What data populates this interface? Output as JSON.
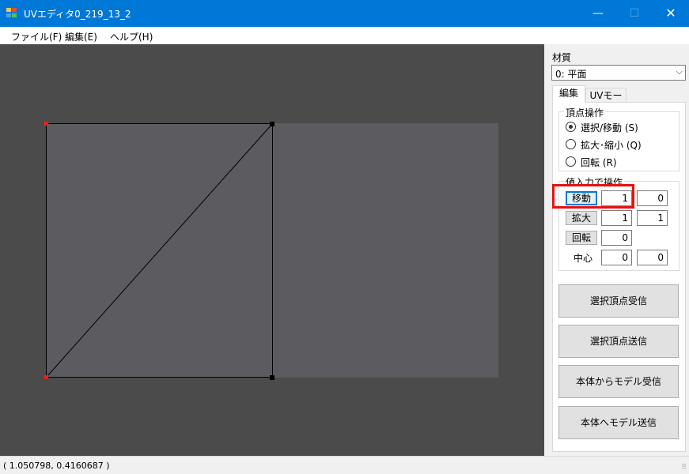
{
  "window": {
    "title": "UVエディタ0_219_13_2",
    "minimize_glyph": "—",
    "maximize_glyph": "☐",
    "close_glyph": "✕"
  },
  "menu": {
    "items": [
      "ファイル(F)",
      "編集(E)",
      "ヘルプ(H)"
    ]
  },
  "panel": {
    "material_label": "材質",
    "material_value": "0: 平面",
    "dropdown_arrow": "⌵",
    "tabs": [
      "編集",
      "UVモーフ"
    ],
    "vertex_group": {
      "title": "頂点操作",
      "options": [
        "選択/移動 (S)",
        "拡大･縮小 (Q)",
        "回転 (R)"
      ],
      "selected_index": 0
    },
    "value_group": {
      "title": "値入力で操作",
      "move_label": "移動",
      "move_x": "1",
      "move_y": "0",
      "scale_label": "拡大",
      "scale_x": "1",
      "scale_y": "1",
      "rotate_label": "回転",
      "rotate_value": "0",
      "center_label": "中心",
      "center_x": "0",
      "center_y": "0"
    },
    "buttons": [
      "選択頂点受信",
      "選択頂点送信",
      "本体からモデル受信",
      "本体へモデル送信"
    ]
  },
  "status": {
    "coordinates": "( 1.050798, 0.4160687 )",
    "grip_glyph": "⠿"
  },
  "colors": {
    "titlebar": "#0078d7",
    "canvas_bg": "#4b4b4b",
    "texture_fill": "#5c5b60",
    "wire": "#000000",
    "selected_vertex": "#ff1a1a",
    "highlight_box": "#e81010"
  }
}
